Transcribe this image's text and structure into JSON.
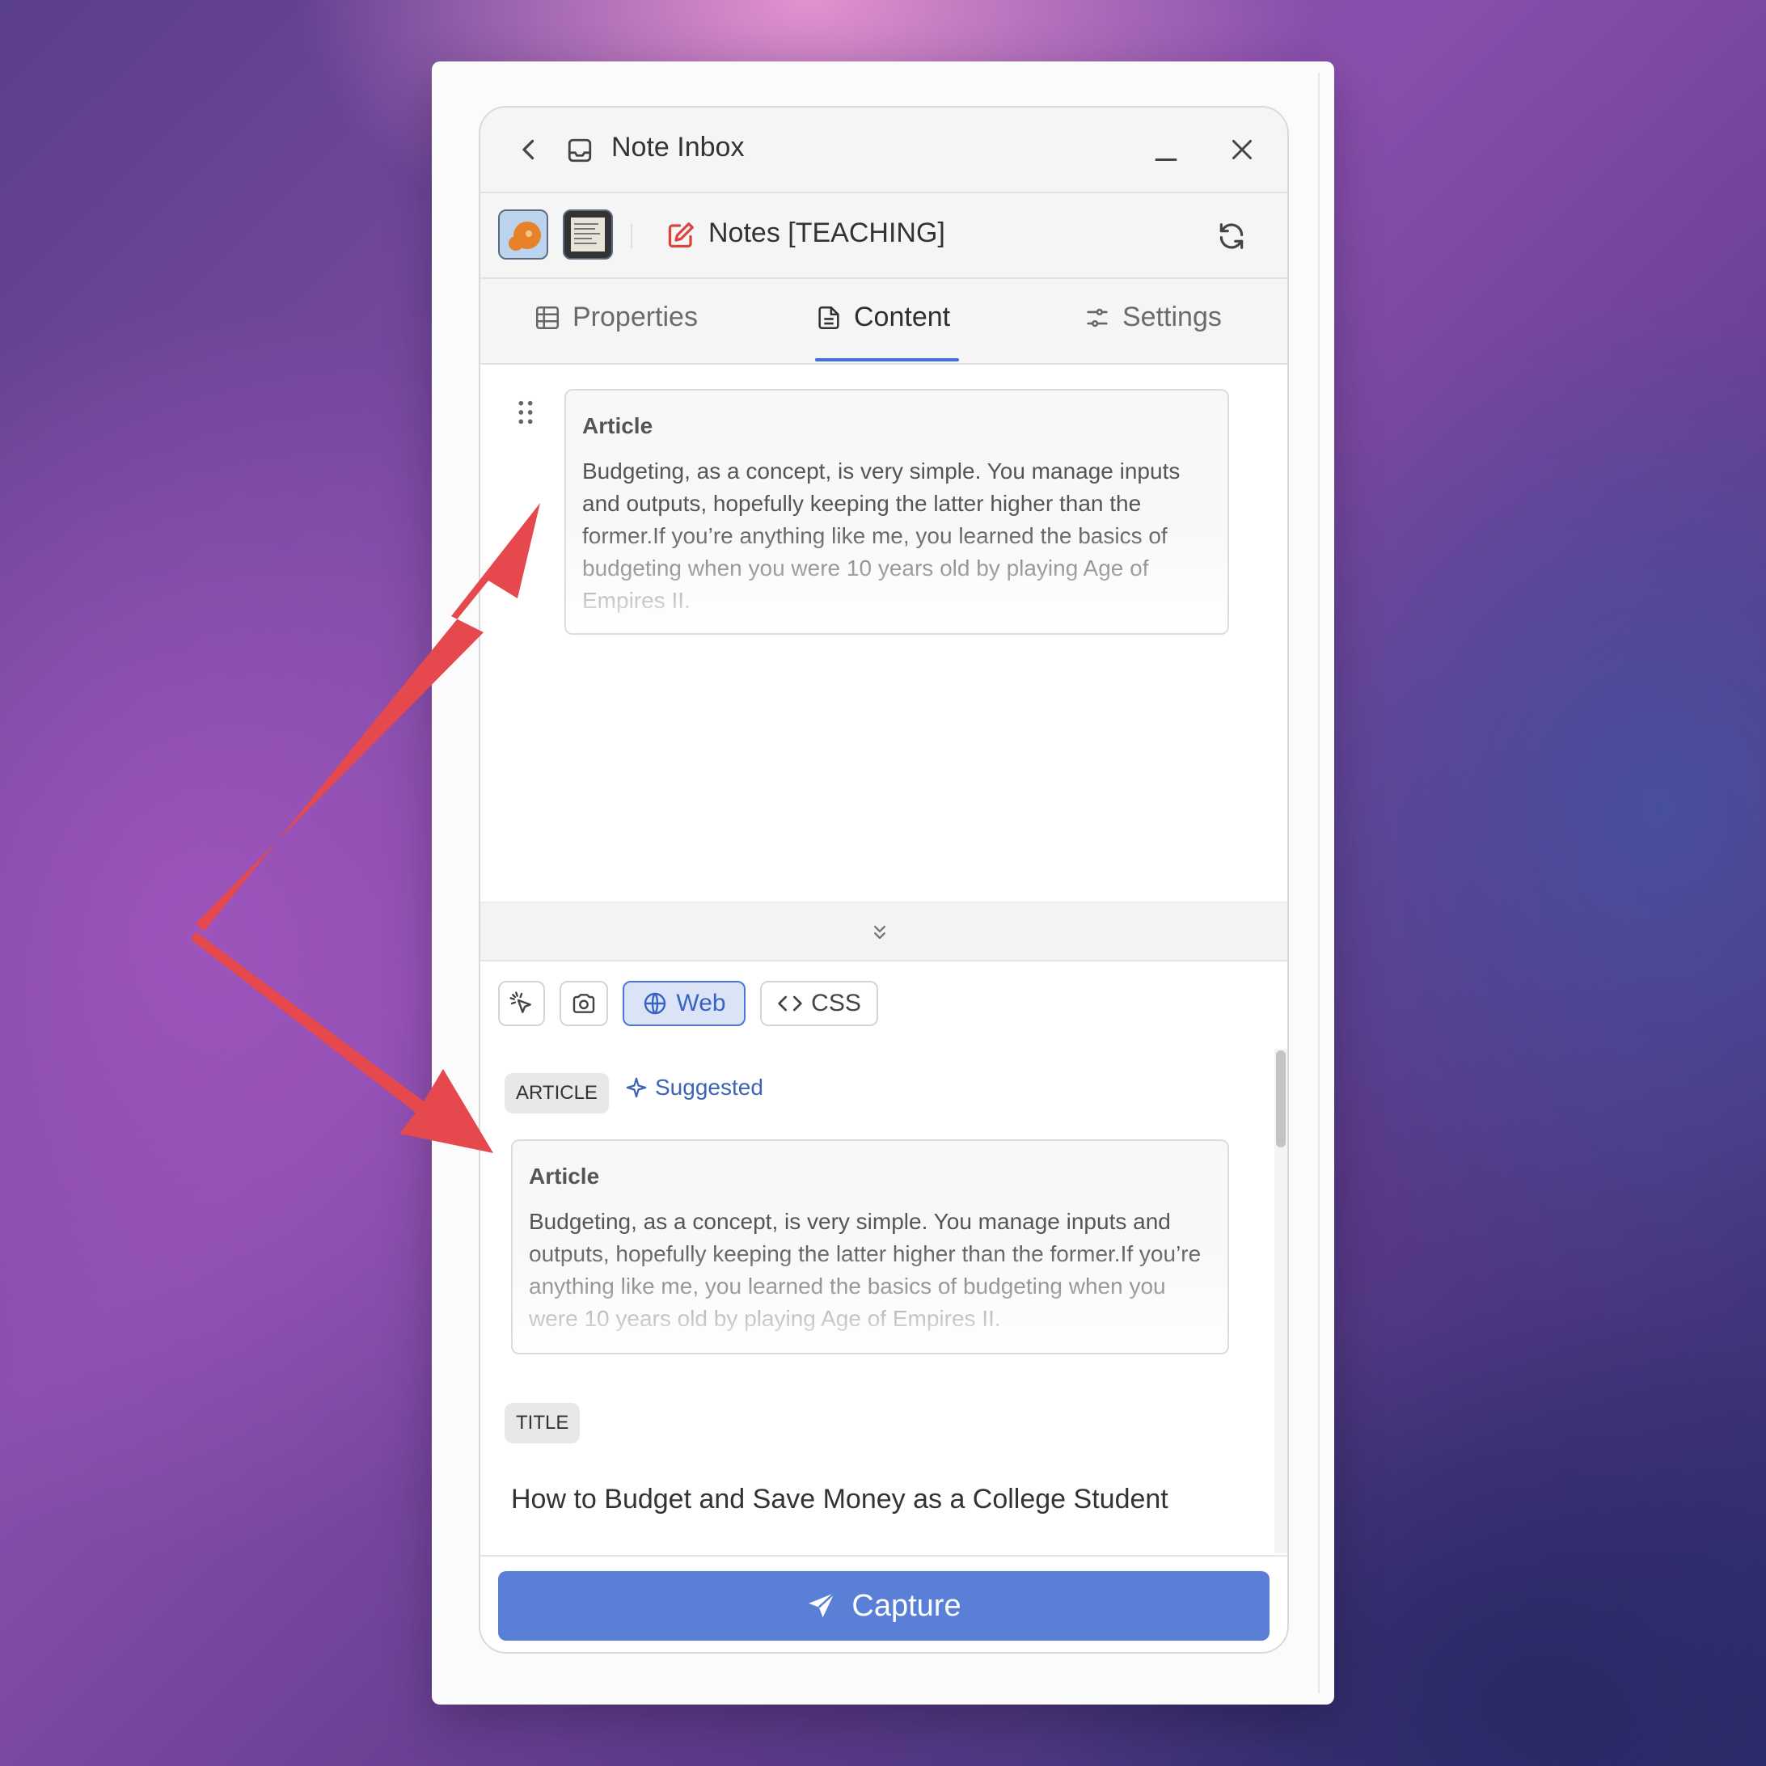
{
  "header": {
    "title": "Note Inbox"
  },
  "notes": {
    "title": "Notes [TEACHING]"
  },
  "tabs": [
    {
      "label": "Properties",
      "icon": "table-icon"
    },
    {
      "label": "Content",
      "icon": "document-icon",
      "active": true
    },
    {
      "label": "Settings",
      "icon": "sliders-icon"
    }
  ],
  "content_card": {
    "heading": "Article",
    "body": "Budgeting, as a concept, is very simple. You manage inputs and outputs, hopefully keeping the latter higher than the former.If you’re anything like me, you learned the basics of budgeting when you were 10 years old by playing Age of Empires II."
  },
  "toolbar": {
    "web_label": "Web",
    "css_label": "CSS"
  },
  "article_section": {
    "badge": "ARTICLE",
    "suggested_label": "Suggested",
    "card_heading": "Article",
    "card_body": "Budgeting, as a concept, is very simple. You manage inputs and outputs, hopefully keeping the latter higher than the former.If you’re anything like me, you learned the basics of budgeting when you were 10 years old by playing Age of Empires II."
  },
  "title_section": {
    "badge": "TITLE",
    "value": "How to Budget and Save Money as a College Student"
  },
  "capture": {
    "label": "Capture"
  },
  "colors": {
    "accent": "#5a7fd6",
    "tab_underline": "#3d6fe0",
    "annotation_arrow": "#e5484d"
  }
}
